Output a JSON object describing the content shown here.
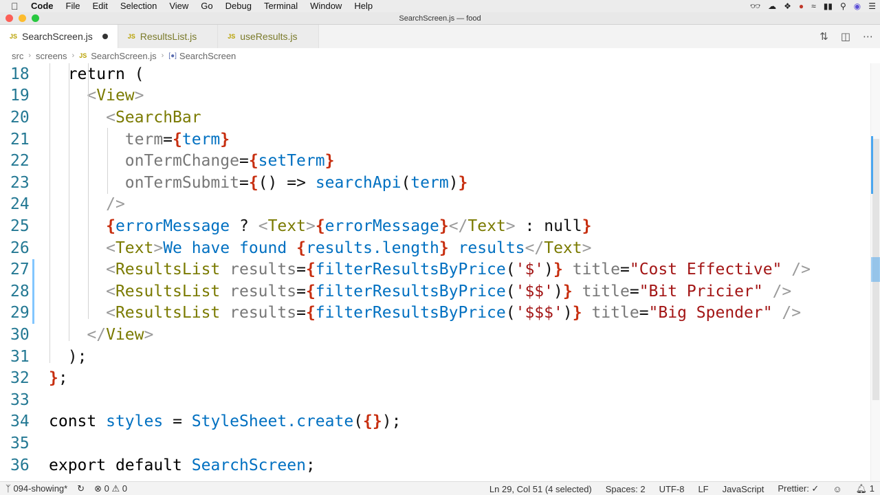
{
  "menubar": {
    "app": "Code",
    "items": [
      "File",
      "Edit",
      "Selection",
      "View",
      "Go",
      "Debug",
      "Terminal",
      "Window",
      "Help"
    ]
  },
  "window": {
    "title": "SearchScreen.js — food"
  },
  "tabs": [
    {
      "label": "SearchScreen.js",
      "icon": "JS",
      "active": true,
      "dirty": true
    },
    {
      "label": "ResultsList.js",
      "icon": "JS",
      "active": false
    },
    {
      "label": "useResults.js",
      "icon": "JS",
      "active": false
    }
  ],
  "breadcrumb": [
    "src",
    "screens",
    "SearchScreen.js",
    "SearchScreen"
  ],
  "editor": {
    "lines": [
      {
        "n": "18",
        "text": "  return ("
      },
      {
        "n": "19",
        "text": "    <View>"
      },
      {
        "n": "20",
        "text": "      <SearchBar"
      },
      {
        "n": "21",
        "text": "        term={term}"
      },
      {
        "n": "22",
        "text": "        onTermChange={setTerm}"
      },
      {
        "n": "23",
        "text": "        onTermSubmit={() => searchApi(term)}"
      },
      {
        "n": "24",
        "text": "      />"
      },
      {
        "n": "25",
        "text": "      {errorMessage ? <Text>{errorMessage}</Text> : null}"
      },
      {
        "n": "26",
        "text": "      <Text>We have found {results.length} results</Text>"
      },
      {
        "n": "27",
        "text": "      <ResultsList results={filterResultsByPrice('$')} title=\"Cost Effective\" />"
      },
      {
        "n": "28",
        "text": "      <ResultsList results={filterResultsByPrice('$$')} title=\"Bit Pricier\" />"
      },
      {
        "n": "29",
        "text": "      <ResultsList results={filterResultsByPrice('$$$')} title=\"Big Spender\" />"
      },
      {
        "n": "30",
        "text": "    </View>"
      },
      {
        "n": "31",
        "text": "  );"
      },
      {
        "n": "32",
        "text": "};"
      },
      {
        "n": "33",
        "text": ""
      },
      {
        "n": "34",
        "text": "const styles = StyleSheet.create({});"
      },
      {
        "n": "35",
        "text": ""
      },
      {
        "n": "36",
        "text": "export default SearchScreen;"
      }
    ]
  },
  "statusbar": {
    "branch": "094-showing*",
    "errors": "0",
    "warnings": "0",
    "position": "Ln 29, Col 51 (4 selected)",
    "spaces": "Spaces: 2",
    "encoding": "UTF-8",
    "eol": "LF",
    "language": "JavaScript",
    "prettier": "Prettier: ✓",
    "notifications": "1"
  }
}
